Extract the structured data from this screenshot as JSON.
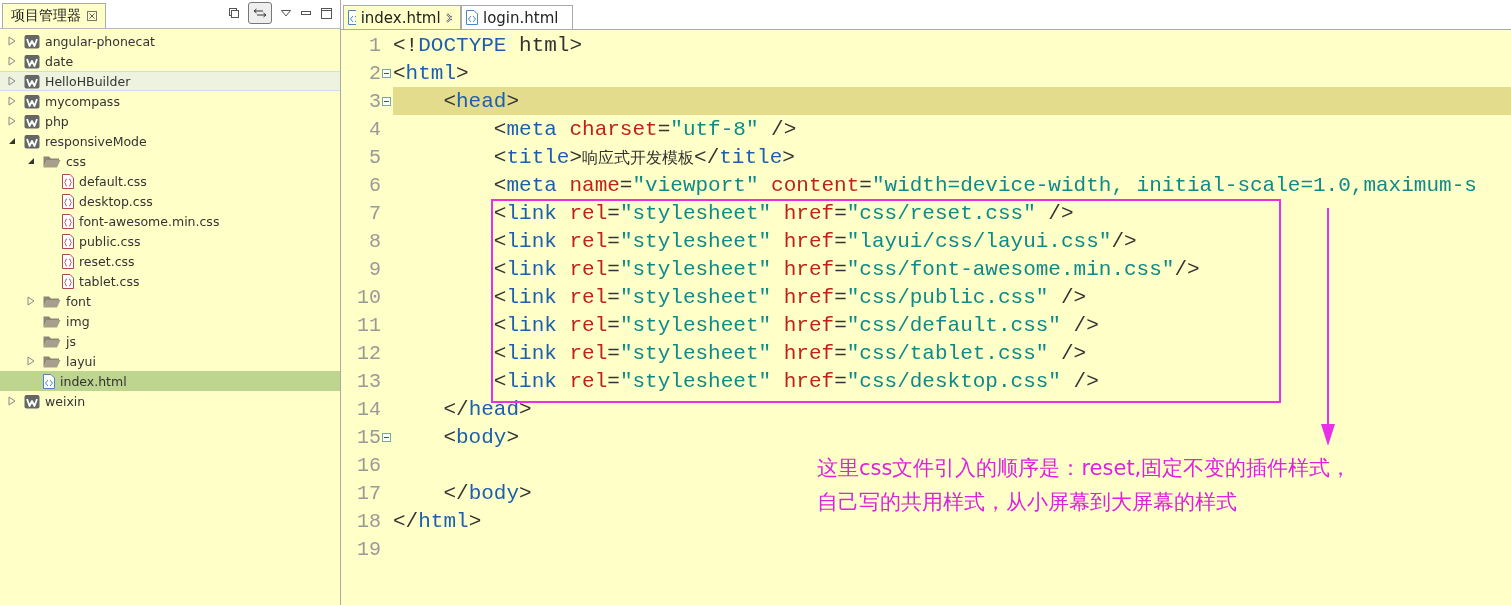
{
  "project_panel": {
    "title": "项目管理器",
    "tree": [
      {
        "label": "angular-phonecat",
        "kind": "project",
        "expanded": false,
        "selected": false,
        "hovered": false
      },
      {
        "label": "date",
        "kind": "project",
        "expanded": false,
        "selected": false,
        "hovered": false
      },
      {
        "label": "HelloHBuilder",
        "kind": "project",
        "expanded": false,
        "selected": false,
        "hovered": true
      },
      {
        "label": "mycompass",
        "kind": "project",
        "expanded": false,
        "selected": false,
        "hovered": false
      },
      {
        "label": "php",
        "kind": "project",
        "expanded": false,
        "selected": false,
        "hovered": false
      },
      {
        "label": "responsiveMode",
        "kind": "project",
        "expanded": true,
        "selected": false,
        "hovered": false,
        "children": [
          {
            "label": "css",
            "kind": "folder",
            "expanded": true,
            "selected": false,
            "hovered": false,
            "children": [
              {
                "label": "default.css",
                "kind": "css",
                "selected": false,
                "hovered": false
              },
              {
                "label": "desktop.css",
                "kind": "css",
                "selected": false,
                "hovered": false
              },
              {
                "label": "font-awesome.min.css",
                "kind": "css",
                "selected": false,
                "hovered": false
              },
              {
                "label": "public.css",
                "kind": "css",
                "selected": false,
                "hovered": false
              },
              {
                "label": "reset.css",
                "kind": "css",
                "selected": false,
                "hovered": false
              },
              {
                "label": "tablet.css",
                "kind": "css",
                "selected": false,
                "hovered": false
              }
            ]
          },
          {
            "label": "font",
            "kind": "folder",
            "expanded": false,
            "selected": false,
            "hovered": false
          },
          {
            "label": "img",
            "kind": "folder",
            "selected": false,
            "hovered": false
          },
          {
            "label": "js",
            "kind": "folder",
            "selected": false,
            "hovered": false
          },
          {
            "label": "layui",
            "kind": "folder",
            "expanded": false,
            "selected": false,
            "hovered": false
          },
          {
            "label": "index.html",
            "kind": "html",
            "selected": true,
            "hovered": false
          }
        ]
      },
      {
        "label": "weixin",
        "kind": "project",
        "expanded": false,
        "selected": false,
        "hovered": false
      }
    ]
  },
  "editor": {
    "tabs": [
      {
        "label": "index.html",
        "selected": true,
        "closable": true
      },
      {
        "label": "login.html",
        "selected": false,
        "closable": false
      }
    ],
    "lines": [
      {
        "number": "1",
        "tokens": [
          {
            "kind": "punct",
            "text": "<!"
          },
          {
            "kind": "tag",
            "text": "DOCTYPE"
          },
          {
            "kind": "punct",
            "text": " html>"
          }
        ]
      },
      {
        "number": "2",
        "fold": true,
        "tokens": [
          {
            "kind": "punct",
            "text": "<"
          },
          {
            "kind": "tag",
            "text": "html"
          },
          {
            "kind": "punct",
            "text": ">"
          }
        ]
      },
      {
        "number": "3",
        "fold": true,
        "current": true,
        "tokens": [
          {
            "kind": "punct",
            "text": "    <"
          },
          {
            "kind": "tag",
            "text": "head"
          },
          {
            "kind": "punct",
            "text": ">"
          }
        ]
      },
      {
        "number": "4",
        "tokens": [
          {
            "kind": "punct",
            "text": "        <"
          },
          {
            "kind": "tag",
            "text": "meta"
          },
          {
            "kind": "attr",
            "text": " charset"
          },
          {
            "kind": "punct",
            "text": "="
          },
          {
            "kind": "value",
            "text": "\"utf-8\""
          },
          {
            "kind": "punct",
            "text": " />"
          }
        ]
      },
      {
        "number": "5",
        "tokens": [
          {
            "kind": "punct",
            "text": "        <"
          },
          {
            "kind": "tag",
            "text": "title"
          },
          {
            "kind": "punct",
            "text": ">"
          },
          {
            "kind": "text",
            "text": "响应式开发模板"
          },
          {
            "kind": "punct",
            "text": "</"
          },
          {
            "kind": "tag",
            "text": "title"
          },
          {
            "kind": "punct",
            "text": ">"
          }
        ]
      },
      {
        "number": "6",
        "tokens": [
          {
            "kind": "punct",
            "text": "        <"
          },
          {
            "kind": "tag",
            "text": "meta"
          },
          {
            "kind": "attr",
            "text": " name"
          },
          {
            "kind": "punct",
            "text": "="
          },
          {
            "kind": "value",
            "text": "\"viewport\""
          },
          {
            "kind": "attr",
            "text": " content"
          },
          {
            "kind": "punct",
            "text": "="
          },
          {
            "kind": "value",
            "text": "\"width=device-width, initial-scale=1.0,maximum-s"
          }
        ]
      },
      {
        "number": "7",
        "tokens": [
          {
            "kind": "punct",
            "text": "        <"
          },
          {
            "kind": "tag",
            "text": "link"
          },
          {
            "kind": "attr",
            "text": " rel"
          },
          {
            "kind": "punct",
            "text": "="
          },
          {
            "kind": "value",
            "text": "\"stylesheet\""
          },
          {
            "kind": "attr",
            "text": " href"
          },
          {
            "kind": "punct",
            "text": "="
          },
          {
            "kind": "value",
            "text": "\"css/reset.css\""
          },
          {
            "kind": "punct",
            "text": " />"
          }
        ]
      },
      {
        "number": "8",
        "tokens": [
          {
            "kind": "punct",
            "text": "        <"
          },
          {
            "kind": "tag",
            "text": "link"
          },
          {
            "kind": "attr",
            "text": " rel"
          },
          {
            "kind": "punct",
            "text": "="
          },
          {
            "kind": "value",
            "text": "\"stylesheet\""
          },
          {
            "kind": "attr",
            "text": " href"
          },
          {
            "kind": "punct",
            "text": "="
          },
          {
            "kind": "value",
            "text": "\"layui/css/layui.css\""
          },
          {
            "kind": "punct",
            "text": "/>"
          }
        ]
      },
      {
        "number": "9",
        "tokens": [
          {
            "kind": "punct",
            "text": "        <"
          },
          {
            "kind": "tag",
            "text": "link"
          },
          {
            "kind": "attr",
            "text": " rel"
          },
          {
            "kind": "punct",
            "text": "="
          },
          {
            "kind": "value",
            "text": "\"stylesheet\""
          },
          {
            "kind": "attr",
            "text": " href"
          },
          {
            "kind": "punct",
            "text": "="
          },
          {
            "kind": "value",
            "text": "\"css/font-awesome.min.css\""
          },
          {
            "kind": "punct",
            "text": "/>"
          }
        ]
      },
      {
        "number": "10",
        "tokens": [
          {
            "kind": "punct",
            "text": "        <"
          },
          {
            "kind": "tag",
            "text": "link"
          },
          {
            "kind": "attr",
            "text": " rel"
          },
          {
            "kind": "punct",
            "text": "="
          },
          {
            "kind": "value",
            "text": "\"stylesheet\""
          },
          {
            "kind": "attr",
            "text": " href"
          },
          {
            "kind": "punct",
            "text": "="
          },
          {
            "kind": "value",
            "text": "\"css/public.css\""
          },
          {
            "kind": "punct",
            "text": " />"
          }
        ]
      },
      {
        "number": "11",
        "tokens": [
          {
            "kind": "punct",
            "text": "        <"
          },
          {
            "kind": "tag",
            "text": "link"
          },
          {
            "kind": "attr",
            "text": " rel"
          },
          {
            "kind": "punct",
            "text": "="
          },
          {
            "kind": "value",
            "text": "\"stylesheet\""
          },
          {
            "kind": "attr",
            "text": " href"
          },
          {
            "kind": "punct",
            "text": "="
          },
          {
            "kind": "value",
            "text": "\"css/default.css\""
          },
          {
            "kind": "punct",
            "text": " />"
          }
        ]
      },
      {
        "number": "12",
        "tokens": [
          {
            "kind": "punct",
            "text": "        <"
          },
          {
            "kind": "tag",
            "text": "link"
          },
          {
            "kind": "attr",
            "text": " rel"
          },
          {
            "kind": "punct",
            "text": "="
          },
          {
            "kind": "value",
            "text": "\"stylesheet\""
          },
          {
            "kind": "attr",
            "text": " href"
          },
          {
            "kind": "punct",
            "text": "="
          },
          {
            "kind": "value",
            "text": "\"css/tablet.css\""
          },
          {
            "kind": "punct",
            "text": " />"
          }
        ]
      },
      {
        "number": "13",
        "tokens": [
          {
            "kind": "punct",
            "text": "        <"
          },
          {
            "kind": "tag",
            "text": "link"
          },
          {
            "kind": "attr",
            "text": " rel"
          },
          {
            "kind": "punct",
            "text": "="
          },
          {
            "kind": "value",
            "text": "\"stylesheet\""
          },
          {
            "kind": "attr",
            "text": " href"
          },
          {
            "kind": "punct",
            "text": "="
          },
          {
            "kind": "value",
            "text": "\"css/desktop.css\""
          },
          {
            "kind": "punct",
            "text": " />"
          }
        ]
      },
      {
        "number": "14",
        "tokens": [
          {
            "kind": "punct",
            "text": "    </"
          },
          {
            "kind": "tag",
            "text": "head"
          },
          {
            "kind": "punct",
            "text": ">"
          }
        ]
      },
      {
        "number": "15",
        "fold": true,
        "tokens": [
          {
            "kind": "punct",
            "text": "    <"
          },
          {
            "kind": "tag",
            "text": "body"
          },
          {
            "kind": "punct",
            "text": ">"
          }
        ]
      },
      {
        "number": "16"
      },
      {
        "number": "17",
        "tokens": [
          {
            "kind": "punct",
            "text": "    </"
          },
          {
            "kind": "tag",
            "text": "body"
          },
          {
            "kind": "punct",
            "text": ">"
          }
        ]
      },
      {
        "number": "18",
        "tokens": [
          {
            "kind": "punct",
            "text": "</"
          },
          {
            "kind": "tag",
            "text": "html"
          },
          {
            "kind": "punct",
            "text": ">"
          }
        ]
      },
      {
        "number": "19"
      }
    ],
    "annotation": {
      "lines": [
        "这里css文件引入的顺序是：reset,固定不变的插件样式，",
        "自己写的共用样式，从小屏幕到大屏幕的样式"
      ]
    }
  }
}
